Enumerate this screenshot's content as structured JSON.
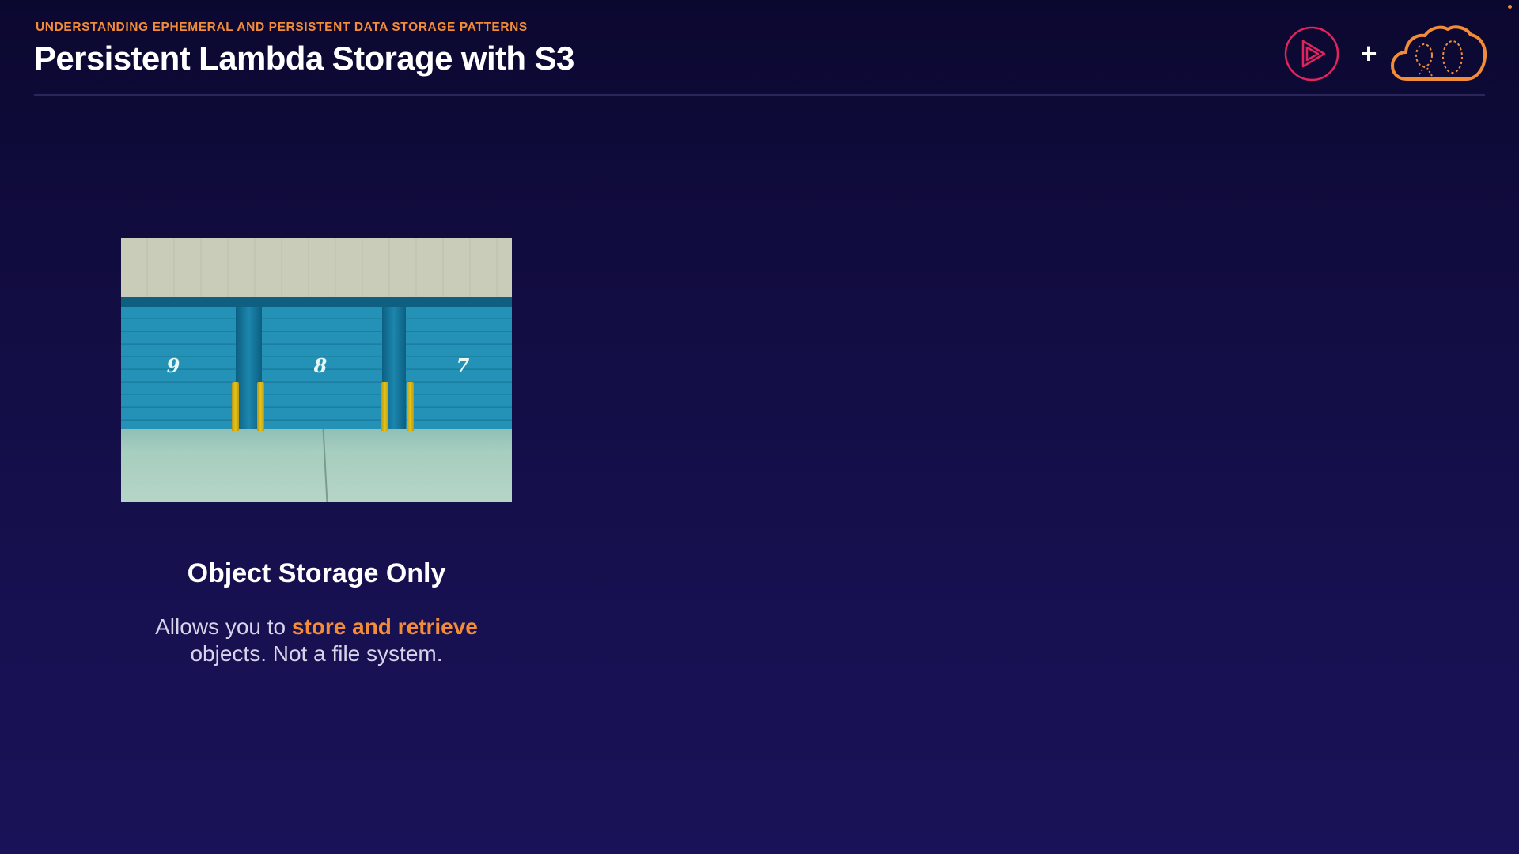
{
  "header": {
    "eyebrow": "UNDERSTANDING EPHEMERAL AND PERSISTENT DATA STORAGE PATTERNS",
    "title": "Persistent Lambda Storage with S3"
  },
  "logos": {
    "left_icon": "pluralsight-play-logo-icon",
    "separator": "+",
    "right_icon": "cloud-logo-icon"
  },
  "card": {
    "image_icon": "storage-units-photo",
    "door_numbers": [
      "9",
      "8",
      "7"
    ],
    "title": "Object Storage Only",
    "description_prefix": "Allows you to ",
    "description_highlight": "store and retrieve",
    "description_suffix": " objects. Not a file system."
  },
  "colors": {
    "accent": "#f28c38",
    "play_logo": "#e0245e",
    "background": "#120d42",
    "text": "#ffffff",
    "muted_text": "#d7d4ea"
  }
}
